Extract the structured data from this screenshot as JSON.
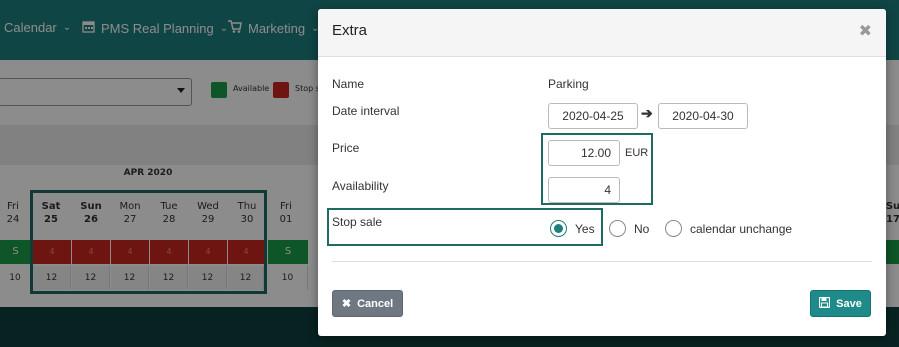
{
  "nav": {
    "items": [
      {
        "label": "Calendar",
        "icon": "none"
      },
      {
        "label": "PMS Real Planning",
        "icon": "calendar-icon"
      },
      {
        "label": "Marketing",
        "icon": "cart-icon"
      }
    ]
  },
  "toolbar": {
    "legend_available": "Available",
    "legend_stop": "Stop s",
    "colors": {
      "available": "#1a9c4a",
      "stop": "#c8261f"
    }
  },
  "calendar": {
    "month": "APR 2020",
    "days": [
      {
        "dow": "Fri",
        "num": "24"
      },
      {
        "dow": "Sat",
        "num": "25"
      },
      {
        "dow": "Sun",
        "num": "26"
      },
      {
        "dow": "Mon",
        "num": "27"
      },
      {
        "dow": "Tue",
        "num": "28"
      },
      {
        "dow": "Wed",
        "num": "29"
      },
      {
        "dow": "Thu",
        "num": "30"
      },
      {
        "dow": "Fri",
        "num": "01"
      }
    ],
    "right_day": {
      "dow": "Su",
      "num": "17"
    },
    "row_status": [
      "S",
      "4",
      "4",
      "4",
      "4",
      "4",
      "4",
      "S"
    ],
    "row_price": [
      "10",
      "12",
      "12",
      "12",
      "12",
      "12",
      "12",
      "10"
    ]
  },
  "modal": {
    "title": "Extra",
    "close_icon": "close-icon",
    "name_label": "Name",
    "name_value": "Parking",
    "date_label": "Date interval",
    "date_from": "2020-04-25",
    "date_to": "2020-04-30",
    "price_label": "Price",
    "price_value": "12.00",
    "currency": "EUR",
    "availability_label": "Availability",
    "availability_value": "4",
    "stop_sale_label": "Stop sale",
    "options": [
      {
        "label": "Yes",
        "selected": true
      },
      {
        "label": "No",
        "selected": false
      },
      {
        "label": "calendar unchange",
        "selected": false
      }
    ],
    "cancel_label": "Cancel",
    "save_label": "Save",
    "accent": "#1e8a8a"
  }
}
